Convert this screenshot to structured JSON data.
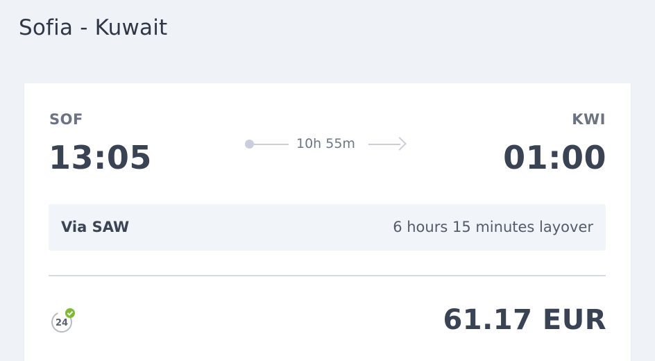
{
  "header": {
    "title": "Sofia - Kuwait"
  },
  "flight": {
    "origin_code": "SOF",
    "destination_code": "KWI",
    "departure_time": "13:05",
    "arrival_time": "01:00",
    "duration": "10h 55m"
  },
  "layover": {
    "via": "Via SAW",
    "duration": "6 hours 15 minutes layover"
  },
  "badge": {
    "text": "24",
    "icon": "24h-guarantee-icon"
  },
  "price": {
    "amount": "61.17 EUR"
  },
  "colors": {
    "background": "#eff3f8",
    "card": "#ffffff",
    "check": "#7dbb2f"
  }
}
